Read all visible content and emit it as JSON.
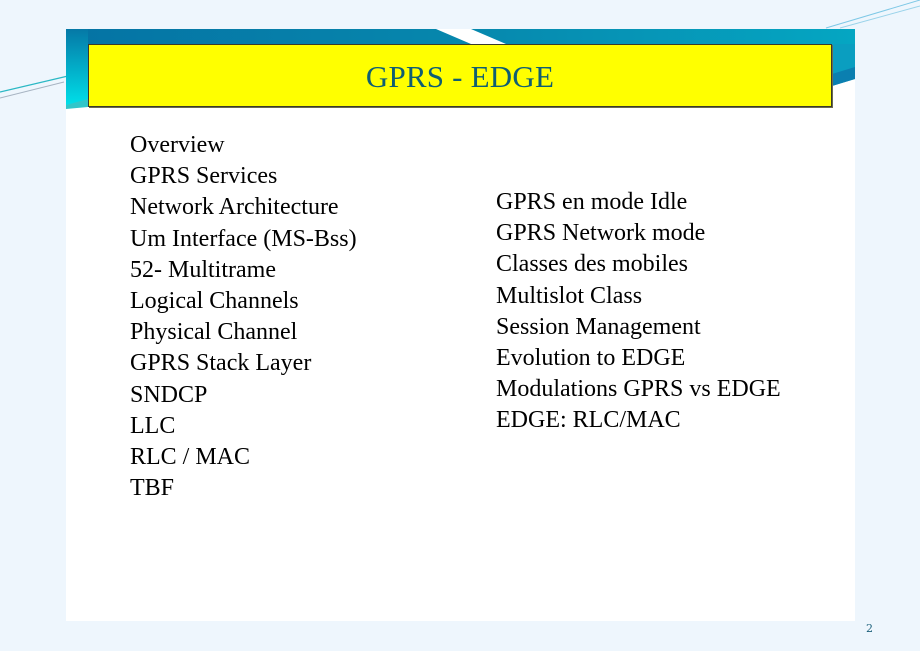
{
  "slide": {
    "title": "GPRS - EDGE",
    "page_number": "2",
    "colors": {
      "background": "#eef6fd",
      "card": "#ffffff",
      "title_box": "#ffff00",
      "title_text": "#0f5e73",
      "banner_dark": "#0a6fa0",
      "banner_light": "#00d0e0",
      "body_text": "#000000"
    }
  },
  "outline": {
    "left_column": [
      "Overview",
      "GPRS Services",
      "Network Architecture",
      "Um Interface (MS-Bss)",
      "52- Multitrame",
      "Logical Channels",
      "Physical Channel",
      "GPRS Stack Layer",
      "SNDCP",
      "LLC",
      "RLC / MAC",
      "TBF"
    ],
    "right_column": [
      "GPRS en mode Idle",
      "GPRS Network mode",
      "Classes des mobiles",
      "Multislot Class",
      "Session Management",
      "Evolution to EDGE",
      "Modulations GPRS vs EDGE",
      "EDGE: RLC/MAC"
    ]
  }
}
